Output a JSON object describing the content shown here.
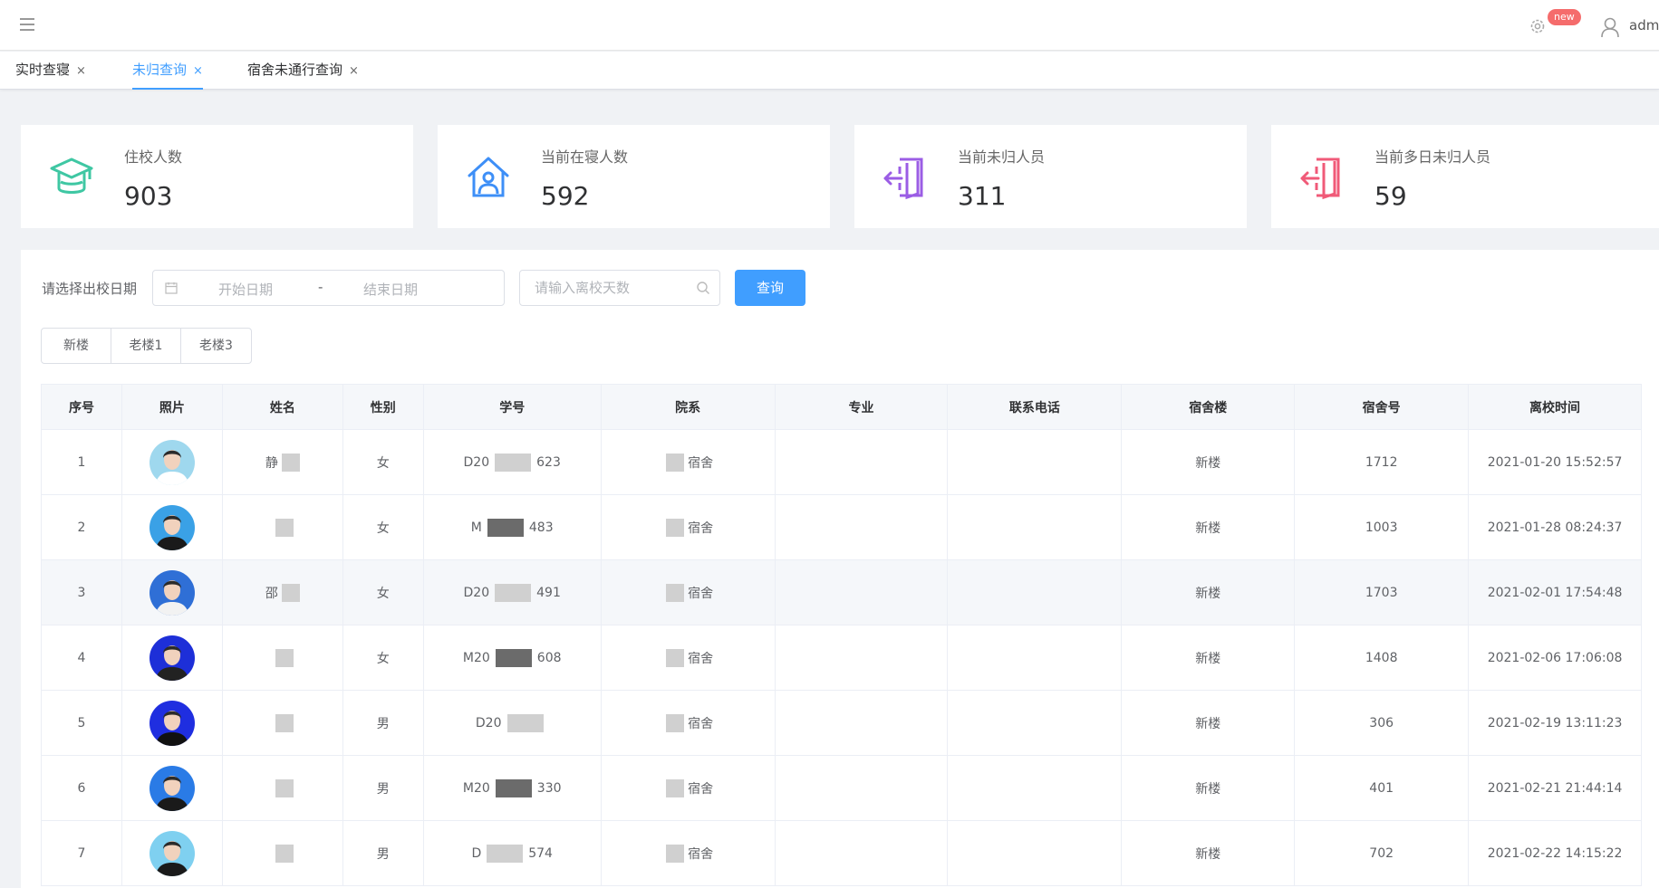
{
  "header": {
    "badge": "new",
    "user_name": "adm"
  },
  "tabs": [
    {
      "label": "实时查寝",
      "close": "×"
    },
    {
      "label": "未归查询",
      "close": "×"
    },
    {
      "label": "宿舍未通行查询",
      "close": "×"
    }
  ],
  "stats": [
    {
      "label": "住校人数",
      "value": "903",
      "icon": "graduation-cap-icon",
      "color": "#3fc7a3"
    },
    {
      "label": "当前在寝人数",
      "value": "592",
      "icon": "home-person-icon",
      "color": "#3e8ff7"
    },
    {
      "label": "当前未归人员",
      "value": "311",
      "icon": "door-exit-icon",
      "color": "#9b5de5"
    },
    {
      "label": "当前多日未归人员",
      "value": "59",
      "icon": "door-exit-icon",
      "color": "#f05a78"
    }
  ],
  "filter": {
    "label": "请选择出校日期",
    "start_placeholder": "开始日期",
    "separator": "-",
    "end_placeholder": "结束日期",
    "days_placeholder": "请输入离校天数",
    "query_label": "查询"
  },
  "buildings": [
    "新楼",
    "老楼1",
    "老楼3"
  ],
  "table": {
    "columns": [
      "序号",
      "照片",
      "姓名",
      "性别",
      "学号",
      "院系",
      "专业",
      "联系电话",
      "宿舍楼",
      "宿舍号",
      "离校时间"
    ],
    "rows": [
      {
        "no": "1",
        "name": "静",
        "gender": "女",
        "sid_prefix": "D20",
        "sid_suffix": "623",
        "dept": "宿舍",
        "major": "",
        "phone": "",
        "building": "新楼",
        "room": "1712",
        "time": "2021-01-20 15:52:57",
        "avatar_bg": "#9fd8ee",
        "shirt": "#ffffff"
      },
      {
        "no": "2",
        "name": "",
        "gender": "女",
        "sid_prefix": "M",
        "sid_suffix": "483",
        "dept": "宿舍",
        "major": "",
        "phone": "",
        "building": "新楼",
        "room": "1003",
        "time": "2021-01-28 08:24:37",
        "avatar_bg": "#3aa1e6",
        "shirt": "#1a1a1a"
      },
      {
        "no": "3",
        "name": "邵",
        "gender": "女",
        "sid_prefix": "D20",
        "sid_suffix": "491",
        "dept": "宿舍",
        "major": "",
        "phone": "",
        "building": "新楼",
        "room": "1703",
        "time": "2021-02-01 17:54:48",
        "avatar_bg": "#2f6fd6",
        "shirt": "#f2f2f2"
      },
      {
        "no": "4",
        "name": "",
        "gender": "女",
        "sid_prefix": "M20",
        "sid_suffix": "608",
        "dept": "宿舍",
        "major": "",
        "phone": "",
        "building": "新楼",
        "room": "1408",
        "time": "2021-02-06 17:06:08",
        "avatar_bg": "#1d2fd8",
        "shirt": "#222222"
      },
      {
        "no": "5",
        "name": "",
        "gender": "男",
        "sid_prefix": "D20",
        "sid_suffix": "",
        "dept": "宿舍",
        "major": "",
        "phone": "",
        "building": "新楼",
        "room": "306",
        "time": "2021-02-19 13:11:23",
        "avatar_bg": "#1f2ee0",
        "shirt": "#111111"
      },
      {
        "no": "6",
        "name": "",
        "gender": "男",
        "sid_prefix": "M20",
        "sid_suffix": "330",
        "dept": "宿舍",
        "major": "",
        "phone": "",
        "building": "新楼",
        "room": "401",
        "time": "2021-02-21 21:44:14",
        "avatar_bg": "#2a7be6",
        "shirt": "#1a1a1a"
      },
      {
        "no": "7",
        "name": "",
        "gender": "男",
        "sid_prefix": "D",
        "sid_suffix": "574",
        "dept": "宿舍",
        "major": "",
        "phone": "",
        "building": "新楼",
        "room": "702",
        "time": "2021-02-22 14:15:22",
        "avatar_bg": "#7fd0f0",
        "shirt": "#1a1a1a"
      }
    ]
  }
}
